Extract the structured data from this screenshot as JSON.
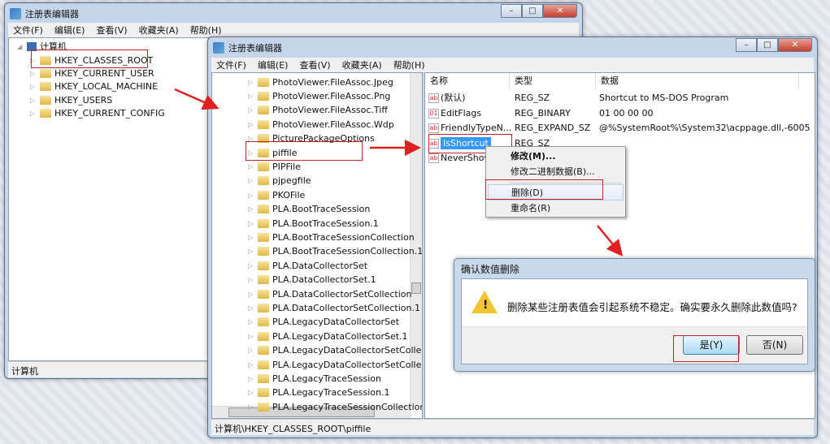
{
  "window1": {
    "title": "注册表编辑器",
    "menu": [
      "文件(F)",
      "编辑(E)",
      "查看(V)",
      "收藏夹(A)",
      "帮助(H)"
    ],
    "tree_root": "计算机",
    "tree": [
      "HKEY_CLASSES_ROOT",
      "HKEY_CURRENT_USER",
      "HKEY_LOCAL_MACHINE",
      "HKEY_USERS",
      "HKEY_CURRENT_CONFIG"
    ],
    "status": "计算机"
  },
  "window2": {
    "title": "注册表编辑器",
    "menu": [
      "文件(F)",
      "编辑(E)",
      "查看(V)",
      "收藏夹(A)",
      "帮助(H)"
    ],
    "tree": [
      "PhotoViewer.FileAssoc.Jpeg",
      "PhotoViewer.FileAssoc.Png",
      "PhotoViewer.FileAssoc.Tiff",
      "PhotoViewer.FileAssoc.Wdp",
      "PicturePackageOptions",
      "piffile",
      "PIPFile",
      "pjpegfile",
      "PKOFile",
      "PLA.BootTraceSession",
      "PLA.BootTraceSession.1",
      "PLA.BootTraceSessionCollection",
      "PLA.BootTraceSessionCollection.1",
      "PLA.DataCollectorSet",
      "PLA.DataCollectorSet.1",
      "PLA.DataCollectorSetCollection",
      "PLA.DataCollectorSetCollection.1",
      "PLA.LegacyDataCollectorSet",
      "PLA.LegacyDataCollectorSet.1",
      "PLA.LegacyDataCollectorSetCollec",
      "PLA.LegacyDataCollectorSetCollec",
      "PLA.LegacyTraceSession",
      "PLA.LegacyTraceSession.1",
      "PLA.LegacyTraceSessionCollection"
    ],
    "columns": [
      "名称",
      "类型",
      "数据"
    ],
    "values": [
      {
        "name": "(默认)",
        "type": "REG_SZ",
        "data": "Shortcut to MS-DOS Program",
        "icon": "ab"
      },
      {
        "name": "EditFlags",
        "type": "REG_BINARY",
        "data": "01 00 00 00",
        "icon": "bin"
      },
      {
        "name": "FriendlyTypeN...",
        "type": "REG_EXPAND_SZ",
        "data": "@%SystemRoot%\\System32\\acppage.dll,-6005",
        "icon": "ab"
      },
      {
        "name": "IsShortcut",
        "type": "REG_SZ",
        "data": "",
        "icon": "ab"
      },
      {
        "name": "NeverShow",
        "type": "",
        "data": "",
        "icon": "ab"
      }
    ],
    "status": "计算机\\HKEY_CLASSES_ROOT\\piffile"
  },
  "context_menu": [
    "修改(M)...",
    "修改二进制数据(B)...",
    "删除(D)",
    "重命名(R)"
  ],
  "dialog": {
    "title": "确认数值删除",
    "message": "删除某些注册表值会引起系统不稳定。确实要永久删除此数值吗?",
    "yes": "是(Y)",
    "no": "否(N)"
  },
  "colors": {
    "highlight": "#3399ff",
    "annotation": "#e02020"
  }
}
